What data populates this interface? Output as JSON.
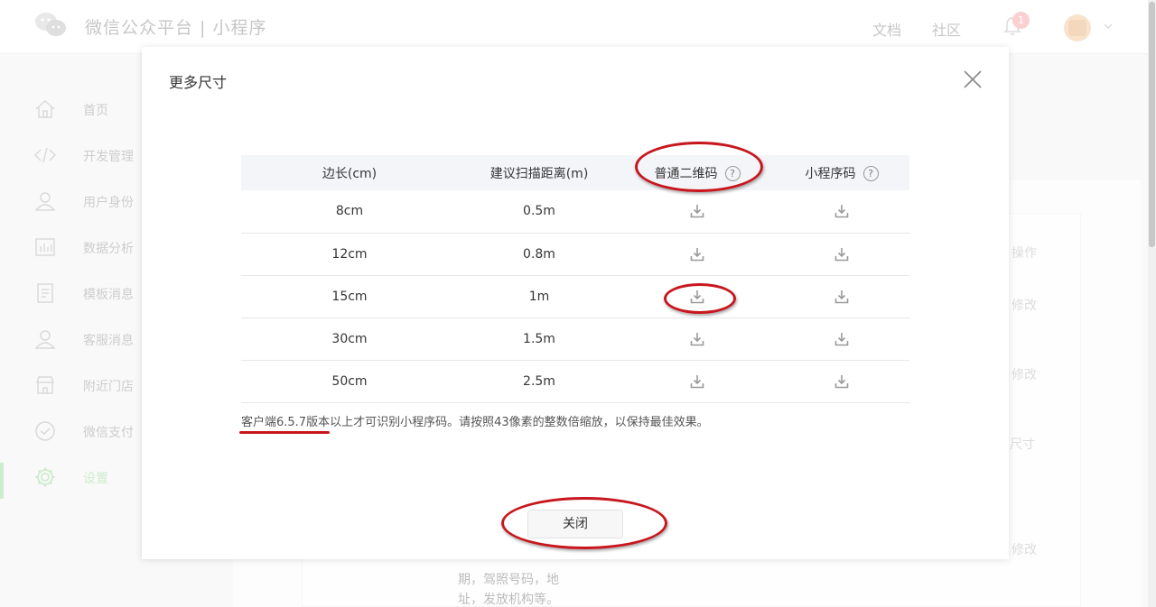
{
  "header": {
    "brand": "微信公众平台 | 小程序",
    "docs_label": "文档",
    "community_label": "社区",
    "notification_count": "1"
  },
  "sidebar": {
    "items": [
      {
        "label": "首页",
        "icon": "home-icon"
      },
      {
        "label": "开发管理",
        "icon": "code-icon"
      },
      {
        "label": "用户身份",
        "icon": "user-icon"
      },
      {
        "label": "数据分析",
        "icon": "chart-icon"
      },
      {
        "label": "模板消息",
        "icon": "document-icon"
      },
      {
        "label": "客服消息",
        "icon": "service-icon"
      },
      {
        "label": "附近门店",
        "icon": "store-icon"
      },
      {
        "label": "微信支付",
        "icon": "pay-icon"
      },
      {
        "label": "设置",
        "icon": "gear-icon"
      }
    ],
    "active_index": 8
  },
  "background": {
    "ops_header": "操作",
    "modify_1": "修改",
    "modify_2": "修改",
    "size_link": "尺寸",
    "modify_3": "修改",
    "text_line1": "期，驾照号码，地",
    "text_line2": "址，发放机构等。"
  },
  "dialog": {
    "title": "更多尺寸",
    "columns": [
      "边长(cm)",
      "建议扫描距离(m)",
      "普通二维码",
      "小程序码"
    ],
    "rows": [
      {
        "side": "8cm",
        "distance": "0.5m"
      },
      {
        "side": "12cm",
        "distance": "0.8m"
      },
      {
        "side": "15cm",
        "distance": "1m"
      },
      {
        "side": "30cm",
        "distance": "1.5m"
      },
      {
        "side": "50cm",
        "distance": "2.5m"
      }
    ],
    "note": "客户端6.5.7版本以上才可识别小程序码。请按照43像素的整数倍缩放，以保持最佳效果。",
    "close_button": "关闭"
  },
  "colors": {
    "accent": "#9ad79a",
    "annotation": "#c8161d"
  }
}
